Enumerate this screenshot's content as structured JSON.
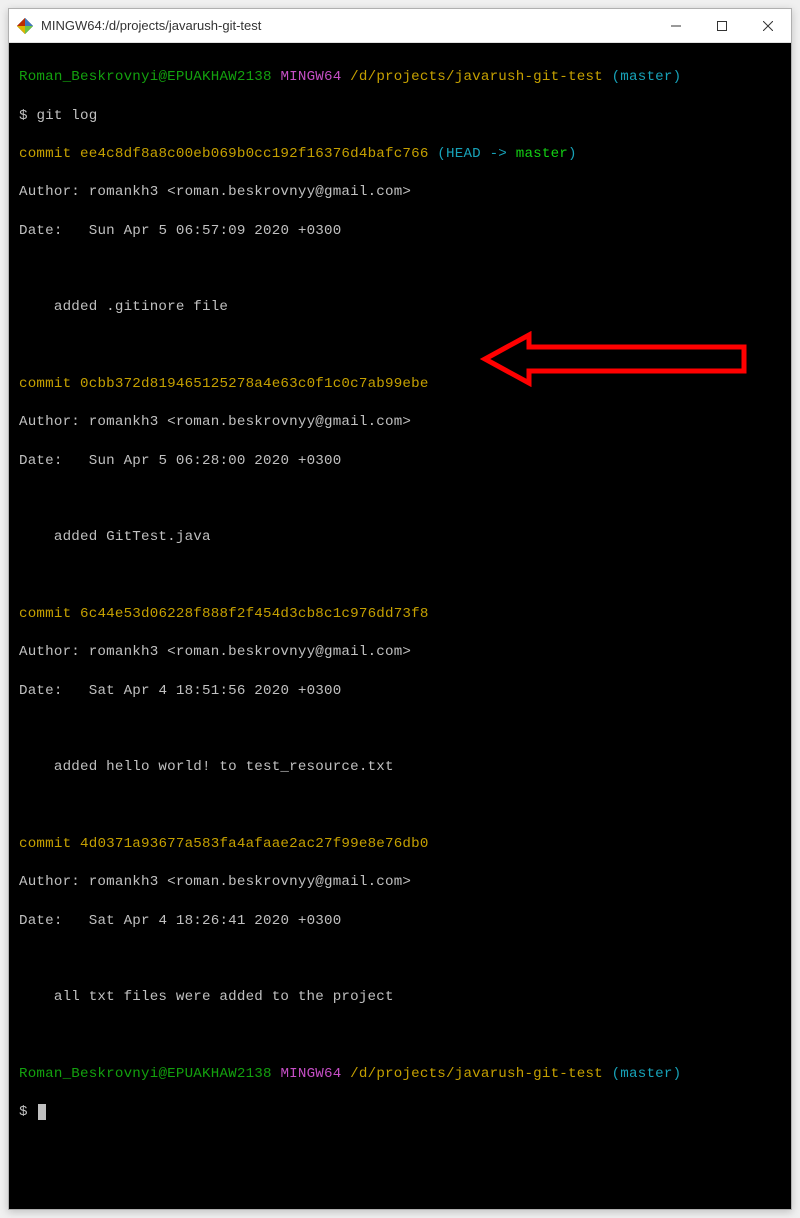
{
  "window": {
    "title": "MINGW64:/d/projects/javarush-git-test"
  },
  "prompt": {
    "user": "Roman_Beskrovnyi",
    "host": "EPUAKHAW2138",
    "shell": "MINGW64",
    "path": "/d/projects/javarush-git-test",
    "branch": "(master)",
    "dollar": "$",
    "command": "git log"
  },
  "commits": [
    {
      "label": "commit",
      "hash": "ee4c8df8a8c00eb069b0cc192f16376d4bafc766",
      "head_ref": "(HEAD -> master)",
      "author_label": "Author:",
      "author_value": "romankh3 <roman.beskrovnyy@gmail.com>",
      "date_label": "Date:",
      "date_value": "Sun Apr 5 06:57:09 2020 +0300",
      "message": "added .gitinore file"
    },
    {
      "label": "commit",
      "hash": "0cbb372d819465125278a4e63c0f1c0c7ab99ebe",
      "head_ref": "",
      "author_label": "Author:",
      "author_value": "romankh3 <roman.beskrovnyy@gmail.com>",
      "date_label": "Date:",
      "date_value": "Sun Apr 5 06:28:00 2020 +0300",
      "message": "added GitTest.java"
    },
    {
      "label": "commit",
      "hash": "6c44e53d06228f888f2f454d3cb8c1c976dd73f8",
      "head_ref": "",
      "author_label": "Author:",
      "author_value": "romankh3 <roman.beskrovnyy@gmail.com>",
      "date_label": "Date:",
      "date_value": "Sat Apr 4 18:51:56 2020 +0300",
      "message": "added hello world! to test_resource.txt"
    },
    {
      "label": "commit",
      "hash": "4d0371a93677a583fa4afaae2ac27f99e8e76db0",
      "head_ref": "",
      "author_label": "Author:",
      "author_value": "romankh3 <roman.beskrovnyy@gmail.com>",
      "date_label": "Date:",
      "date_value": "Sat Apr 4 18:26:41 2020 +0300",
      "message": "all txt files were added to the project"
    }
  ],
  "prompt2": {
    "user": "Roman_Beskrovnyi",
    "host": "EPUAKHAW2138",
    "shell": "MINGW64",
    "path": "/d/projects/javarush-git-test",
    "branch": "(master)",
    "dollar": "$"
  },
  "annotation": {
    "arrow_color": "#ff0000"
  }
}
